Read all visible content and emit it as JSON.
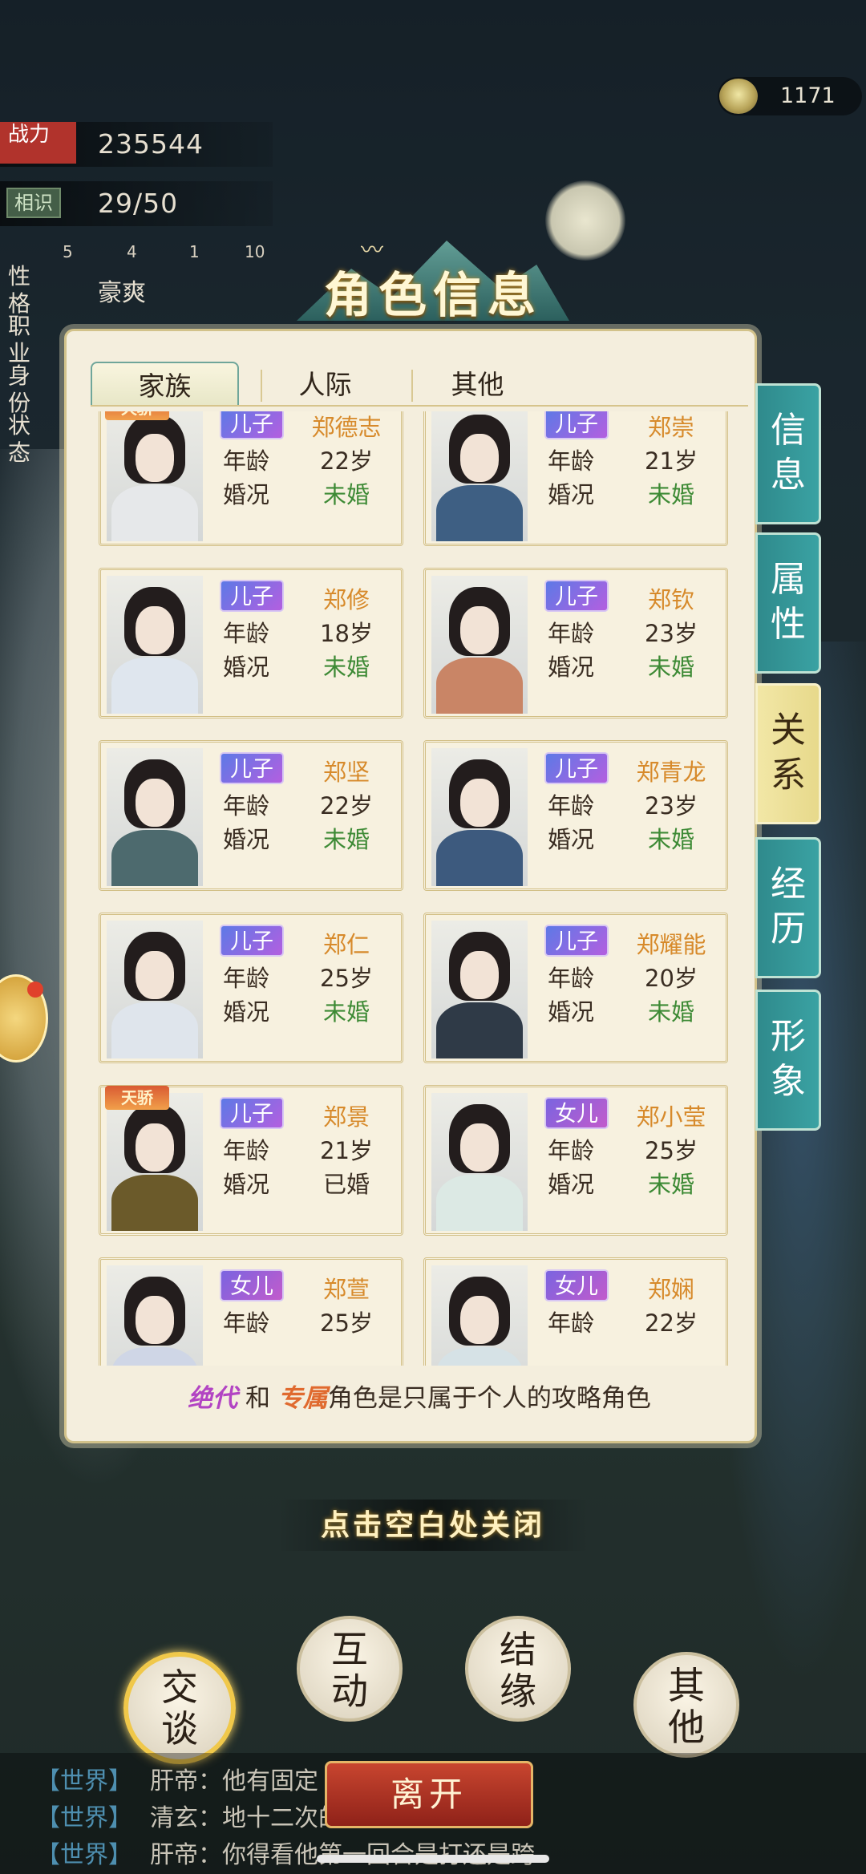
{
  "currency": {
    "value": "1171",
    "icon": "tea-bowl-icon"
  },
  "stats": {
    "power_label": "战力",
    "power_value": "235544",
    "acquaint_label": "相识",
    "acquaint_value": "29/50",
    "gems": [
      "5",
      "4",
      "1",
      "10"
    ],
    "traits": [
      {
        "label": "性格",
        "value": "豪爽"
      },
      {
        "label": "职业",
        "value": ""
      },
      {
        "label": "身份",
        "value": ""
      },
      {
        "label": "状态",
        "value": ""
      }
    ]
  },
  "title": "角色信息",
  "tabs": [
    "家族",
    "人际",
    "其他"
  ],
  "active_tab": "家族",
  "side_tabs": [
    "信息",
    "属性",
    "关系",
    "经历",
    "形象"
  ],
  "active_side_tab": "关系",
  "field_labels": {
    "age": "年龄",
    "marriage": "婚况"
  },
  "members": [
    {
      "role": "儿子",
      "name": "郑德志",
      "age": "22岁",
      "marriage": "未婚",
      "badge": "天骄",
      "robe": "#e6e8ea"
    },
    {
      "role": "儿子",
      "name": "郑崇",
      "age": "21岁",
      "marriage": "未婚",
      "badge": "",
      "robe": "#3e5f83"
    },
    {
      "role": "儿子",
      "name": "郑修",
      "age": "18岁",
      "marriage": "未婚",
      "badge": "",
      "robe": "#dfe6ee"
    },
    {
      "role": "儿子",
      "name": "郑钦",
      "age": "23岁",
      "marriage": "未婚",
      "badge": "",
      "robe": "#c98566"
    },
    {
      "role": "儿子",
      "name": "郑坚",
      "age": "22岁",
      "marriage": "未婚",
      "badge": "",
      "robe": "#4d6a6e"
    },
    {
      "role": "儿子",
      "name": "郑青龙",
      "age": "23岁",
      "marriage": "未婚",
      "badge": "",
      "robe": "#3d5a7e"
    },
    {
      "role": "儿子",
      "name": "郑仁",
      "age": "25岁",
      "marriage": "未婚",
      "badge": "",
      "robe": "#dfe5ec"
    },
    {
      "role": "儿子",
      "name": "郑耀能",
      "age": "20岁",
      "marriage": "未婚",
      "badge": "",
      "robe": "#2f3a47"
    },
    {
      "role": "儿子",
      "name": "郑景",
      "age": "21岁",
      "marriage": "已婚",
      "badge": "天骄",
      "robe": "#6b5a2a"
    },
    {
      "role": "女儿",
      "name": "郑小莹",
      "age": "25岁",
      "marriage": "未婚",
      "badge": "",
      "robe": "#dce9e4"
    },
    {
      "role": "女儿",
      "name": "郑萱",
      "age": "25岁",
      "marriage": "",
      "badge": "",
      "robe": "#cfd6e6"
    },
    {
      "role": "女儿",
      "name": "郑娴",
      "age": "22岁",
      "marriage": "",
      "badge": "",
      "robe": "#d6e2e6"
    }
  ],
  "footnote": {
    "part_a": "绝代",
    "join": "和",
    "part_b": "专属",
    "rest": "角色是只属于个人的攻略角色"
  },
  "close_hint": "点击空白处关闭",
  "actions": [
    "交谈",
    "互动",
    "结缘",
    "其他"
  ],
  "leave_label": "离开",
  "chat": [
    {
      "channel": "【世界】",
      "text": "肝帝：他有固定"
    },
    {
      "channel": "【世界】",
      "text": "清玄：地十二次的"
    },
    {
      "channel": "【世界】",
      "text": "肝帝：你得看他第一回合是打还是跨"
    }
  ]
}
